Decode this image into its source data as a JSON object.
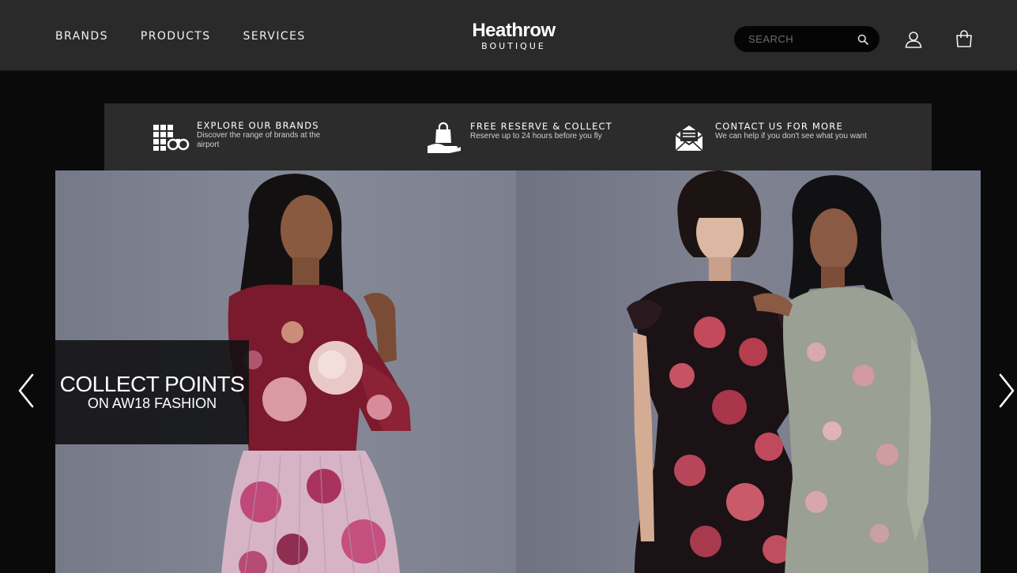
{
  "header": {
    "nav": [
      "BRANDS",
      "PRODUCTS",
      "SERVICES"
    ],
    "logo_main": "Heathrow",
    "logo_sub": "BOUTIQUE",
    "search_placeholder": "SEARCH",
    "icons": [
      "search-icon",
      "user-icon",
      "shopping-bag-icon"
    ]
  },
  "info_bar": [
    {
      "icon": "brands-binoculars-icon",
      "title": "EXPLORE OUR BRANDS",
      "desc_line1": "Discover the range of brands at the",
      "desc_line2": "airport"
    },
    {
      "icon": "bag-in-hand-icon",
      "title": "FREE RESERVE & COLLECT",
      "desc_line1": "Reserve up to 24 hours before you fly"
    },
    {
      "icon": "envelope-icon",
      "title": "CONTACT US FOR MORE",
      "desc_line1": "We can help if you don't see what you want"
    }
  ],
  "hero": {
    "promo_title": "COLLECT POINTS",
    "promo_sub": "ON AW18 FASHION",
    "icons": [
      "chevron-left-icon",
      "chevron-right-icon"
    ]
  }
}
